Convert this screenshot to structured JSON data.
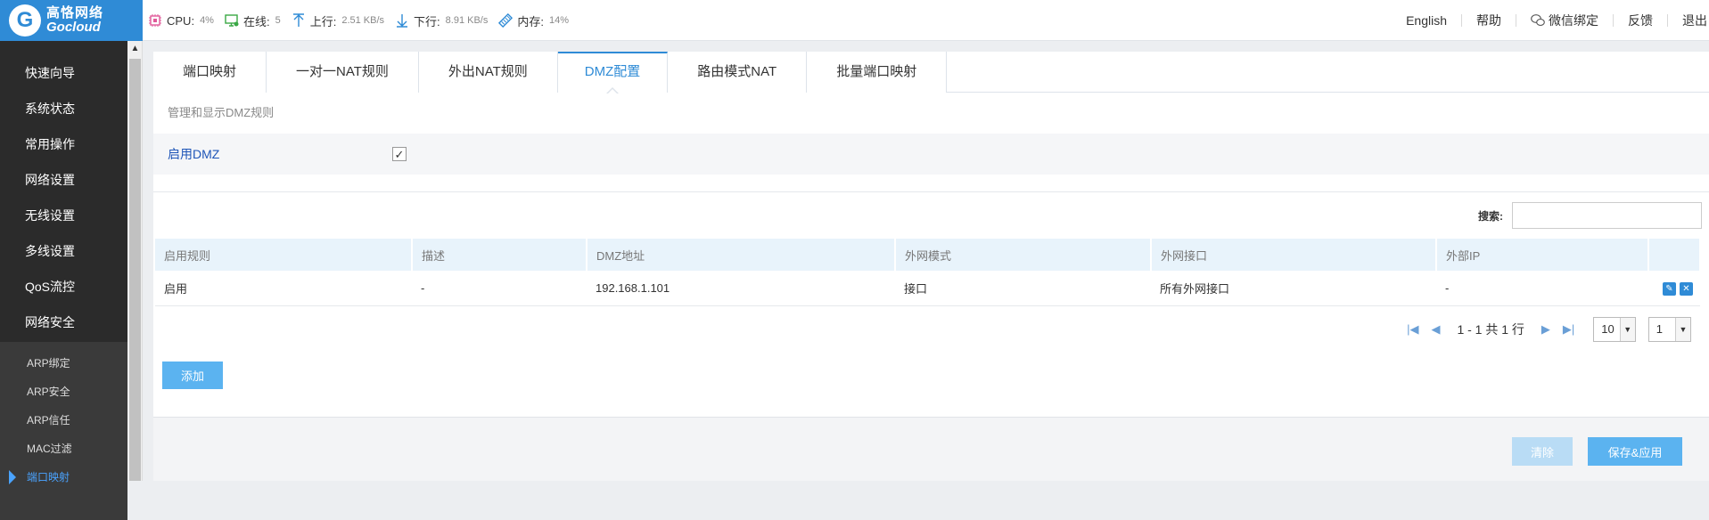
{
  "brand": {
    "name_cn": "高恪网络",
    "name_en": "Gocloud",
    "logo_letter": "G"
  },
  "stats": [
    {
      "icon": "cpu-icon",
      "label": "CPU:",
      "value": "4%"
    },
    {
      "icon": "online-icon",
      "label": "在线:",
      "value": "5"
    },
    {
      "icon": "upload-icon",
      "label": "上行:",
      "value": "2.51 KB/s"
    },
    {
      "icon": "download-icon",
      "label": "下行:",
      "value": "8.91 KB/s"
    },
    {
      "icon": "memory-icon",
      "label": "内存:",
      "value": "14%"
    }
  ],
  "topnav": {
    "english": "English",
    "help": "帮助",
    "wechat": "微信绑定",
    "feedback": "反馈",
    "logout": "退出"
  },
  "sidebar": {
    "items": [
      "快速向导",
      "系统状态",
      "常用操作",
      "网络设置",
      "无线设置",
      "多线设置",
      "QoS流控",
      "网络安全"
    ],
    "subitems": [
      "ARP绑定",
      "ARP安全",
      "ARP信任",
      "MAC过滤",
      "端口映射"
    ],
    "active_sub": "端口映射"
  },
  "tabs": [
    "端口映射",
    "一对一NAT规则",
    "外出NAT规则",
    "DMZ配置",
    "路由模式NAT",
    "批量端口映射"
  ],
  "active_tab": "DMZ配置",
  "description": "管理和显示DMZ规则",
  "enable": {
    "label": "启用DMZ",
    "checked": true,
    "mark": "✓"
  },
  "search": {
    "label": "搜索:",
    "value": ""
  },
  "table": {
    "columns": [
      "启用规则",
      "描述",
      "DMZ地址",
      "外网模式",
      "外网接口",
      "外部IP",
      ""
    ],
    "rows": [
      {
        "enabled": "启用",
        "desc": "-",
        "dmz_addr": "192.168.1.101",
        "wan_mode": "接口",
        "wan_iface": "所有外网接口",
        "ext_ip": "-"
      }
    ]
  },
  "pager": {
    "info": "1 - 1 共 1 行",
    "page_size": "10",
    "page": "1"
  },
  "buttons": {
    "add": "添加",
    "clear": "清除",
    "save": "保存&应用"
  },
  "colors": {
    "accent": "#2f8bd6",
    "sidebar_bg": "#2b2b2b",
    "button": "#5bb3f0"
  }
}
